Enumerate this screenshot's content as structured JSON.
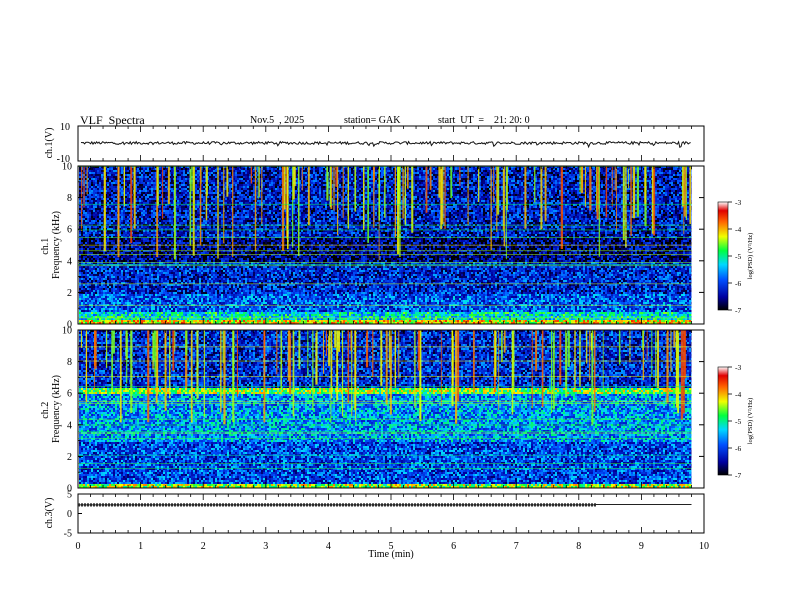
{
  "header": {
    "title": "VLF  Spectra",
    "date": "Nov.5  , 2025",
    "station": "station= GAK",
    "start_ut": "start  UT  =    21: 20: 0"
  },
  "colors": {
    "background": "#ffffff",
    "axis": "#000000",
    "signal_trace": "#111111"
  },
  "chart_data": [
    {
      "type": "line",
      "panel": "ch1-waveform",
      "ylabel": "ch.1(V)",
      "ylim": [
        -10,
        10
      ],
      "yticks": [
        "10",
        "-10"
      ],
      "series": [
        {
          "values_description_note": "",
          "level": 0
        }
      ]
    },
    {
      "type": "heatmap",
      "panel": "ch1-spectrogram",
      "ylabel": "ch.1\nFrequency  (kHz)",
      "ylabel_lines": [
        "ch.1",
        "Frequency  (kHz)"
      ],
      "ylim": [
        0,
        10
      ],
      "yticks": [
        "0",
        "2",
        "4",
        "6",
        "8",
        "10"
      ],
      "colorbar": {
        "label": "log(PSD) (V²/Hz)",
        "ticks": [
          "-3",
          "-4",
          "-5",
          "-6",
          "-7"
        ],
        "range": [
          -7,
          -3
        ]
      },
      "bands_khz": [
        {
          "from": 0.0,
          "to": 0.3,
          "level": -4.2
        },
        {
          "from": 0.3,
          "to": 0.8,
          "level": -5.2
        },
        {
          "from": 0.8,
          "to": 2.0,
          "level": -5.9
        },
        {
          "from": 2.0,
          "to": 4.0,
          "level": -6.2
        },
        {
          "from": 4.0,
          "to": 5.5,
          "level": -6.6
        },
        {
          "from": 5.5,
          "to": 10.0,
          "level": -6.3
        }
      ]
    },
    {
      "type": "heatmap",
      "panel": "ch2-spectrogram",
      "ylabel": "ch.2\nFrequency  (kHz)",
      "ylabel_lines": [
        "ch.2",
        "Frequency  (kHz)"
      ],
      "ylim": [
        0,
        10
      ],
      "yticks": [
        "0",
        "2",
        "4",
        "6",
        "8",
        "10"
      ],
      "colorbar": {
        "label": "log(PSD) (V²/Hz)",
        "ticks": [
          "-3",
          "-4",
          "-5",
          "-6",
          "-7"
        ],
        "range": [
          -7,
          -3
        ]
      },
      "bands_khz": [
        {
          "from": 0.0,
          "to": 0.3,
          "level": -4.5
        },
        {
          "from": 0.3,
          "to": 3.0,
          "level": -6.0
        },
        {
          "from": 3.0,
          "to": 6.0,
          "level": -5.6
        },
        {
          "from": 6.0,
          "to": 6.4,
          "level": -4.6
        },
        {
          "from": 6.4,
          "to": 10.0,
          "level": -6.2
        }
      ]
    },
    {
      "type": "line",
      "panel": "ch3-signal",
      "ylabel": "ch.3(V)",
      "ylim": [
        -5,
        5
      ],
      "yticks": [
        "5",
        "0",
        "-5"
      ],
      "series": [
        {
          "x": [
            0,
            8.25,
            8.25,
            9.8
          ],
          "values": [
            2.2,
            2.2,
            2.3,
            2.3
          ]
        }
      ],
      "xlabel": "Time  (min)",
      "xlim": [
        0,
        10
      ],
      "xticks": [
        "0",
        "1",
        "2",
        "3",
        "4",
        "5",
        "6",
        "7",
        "8",
        "9",
        "10"
      ],
      "data_end_min": 9.8
    }
  ]
}
